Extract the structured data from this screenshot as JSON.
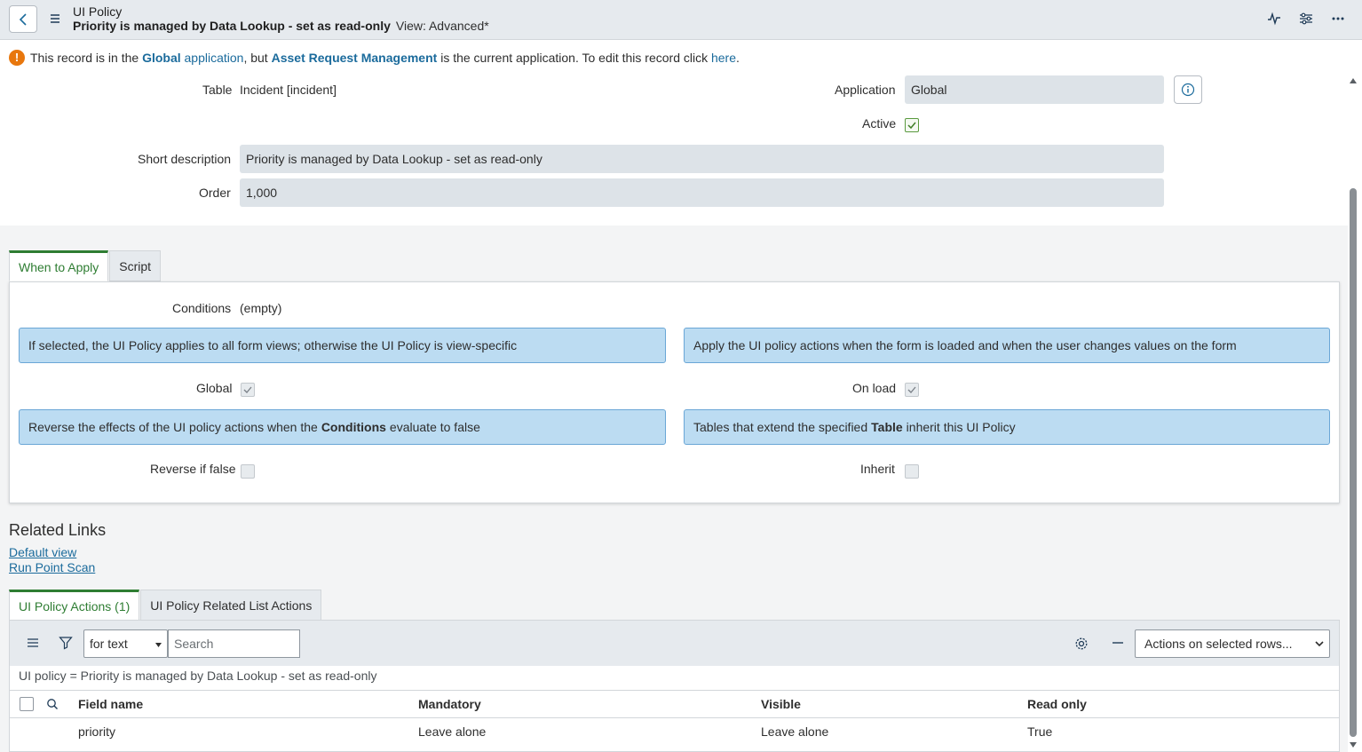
{
  "header": {
    "title": "UI Policy",
    "record_name": "Priority is managed by Data Lookup - set as read-only",
    "view": "View: Advanced*"
  },
  "banner": {
    "part1": "This record is in the",
    "global": "Global",
    "application": "application",
    "part2": ", but",
    "current_app": "Asset Request Management",
    "part3": "is the current application. To edit this record click",
    "here": "here",
    "period": "."
  },
  "form": {
    "table_label": "Table",
    "table_value": "Incident [incident]",
    "application_label": "Application",
    "application_value": "Global",
    "active_label": "Active",
    "short_desc_label": "Short description",
    "short_desc_value": "Priority is managed by Data Lookup - set as read-only",
    "order_label": "Order",
    "order_value": "1,000"
  },
  "tabs": [
    "When to Apply",
    "Script"
  ],
  "when_to_apply": {
    "conditions_label": "Conditions",
    "conditions_value": "(empty)",
    "hint_global": "If selected, the UI Policy applies to all form views; otherwise the UI Policy is view-specific",
    "hint_onload": "Apply the UI policy actions when the form is loaded and when the user changes values on the form",
    "global_label": "Global",
    "onload_label": "On load",
    "hint_reverse_a": "Reverse the effects of the UI policy actions when the",
    "hint_reverse_b": "Conditions",
    "hint_reverse_c": "evaluate to false",
    "hint_inherit_a": "Tables that extend the specified",
    "hint_inherit_b": "Table",
    "hint_inherit_c": "inherit this UI Policy",
    "reverse_label": "Reverse if false",
    "inherit_label": "Inherit"
  },
  "related_links": {
    "title": "Related Links",
    "links": [
      "Default view",
      "Run Point Scan"
    ]
  },
  "related_tabs": [
    "UI Policy Actions (1)",
    "UI Policy Related List Actions"
  ],
  "list": {
    "filter_select": "for text",
    "search_placeholder": "Search",
    "actions_select": "Actions on selected rows...",
    "breadcrumb": "UI policy = Priority is managed by Data Lookup - set as read-only",
    "columns": [
      "Field name",
      "Mandatory",
      "Visible",
      "Read only"
    ],
    "rows": [
      {
        "field": "priority",
        "mandatory": "Leave alone",
        "visible": "Leave alone",
        "readonly": "True"
      }
    ]
  }
}
